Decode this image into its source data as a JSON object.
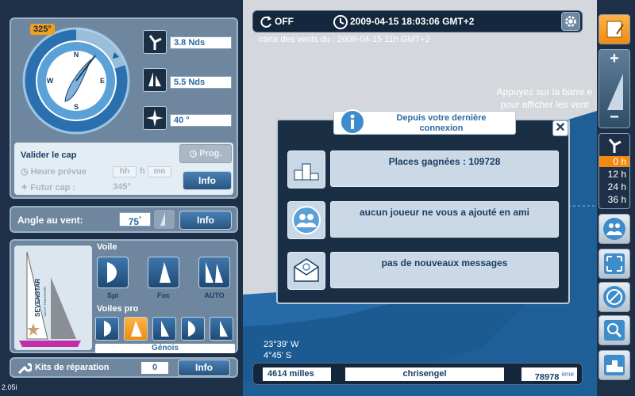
{
  "topbar": {
    "status": "OFF",
    "datetime": "2009-04-15 18:03:06 GMT+2"
  },
  "map": {
    "wind_date": "carte des vents du :  2009-04-15 11h GMT+2",
    "tip_line1": "Appuyez sur la barre e",
    "tip_line2": "pour afficher les vent",
    "lon": "23°39' W",
    "lat": "4°45' S"
  },
  "bottombar": {
    "distance": "4614 milles",
    "username": "chrisengel",
    "rank": "78978",
    "rank_suffix": "ème"
  },
  "compass": {
    "heading_badge": "325°",
    "dial_labels": [
      "N",
      "E",
      "S",
      "W"
    ]
  },
  "readings": {
    "wind_speed": "3.8 Nds",
    "boat_speed": "5.5 Nds",
    "wind_direction": "40 °"
  },
  "cap": {
    "title": "Valider le cap",
    "prog_label": "Prog.",
    "heure_label": "Heure prévue",
    "hh": "hh",
    "h": "h",
    "mn": "mn",
    "futur_label": "Futur cap :",
    "futur_value": "345°",
    "info_label": "Info"
  },
  "angle": {
    "label": "Angle au vent:",
    "value": "75",
    "unit": "°",
    "info_label": "Info"
  },
  "sails": {
    "voile_label": "Voile",
    "spi": "Spi",
    "foc": "Foc",
    "auto": "AUTO",
    "pro_label": "Voiles pro",
    "pro_selected": "Génois",
    "boat_brand": "SEVENSTAR",
    "boat_sub": "YACHT TRANSPORT"
  },
  "kits": {
    "label": "Kits de réparation",
    "value": "0",
    "info_label": "Info"
  },
  "version": "2.05i",
  "popup": {
    "title_line1": "Depuis votre dernière",
    "title_line2": "connexion",
    "close": "✕",
    "rows": [
      {
        "text": "Places gagnées :  109728"
      },
      {
        "text": "aucun joueur ne vous a ajouté en ami"
      },
      {
        "text": "pas de nouveaux messages"
      }
    ]
  },
  "toolbar": {
    "plus": "+",
    "minus": "−",
    "times": [
      "0 h",
      "12 h",
      "24 h",
      "36 h"
    ],
    "selected_time": "0 h"
  },
  "colors": {
    "panel": "#6e879e",
    "accent": "#f08a10",
    "sea": "#1f5f98",
    "land": "#d4d8dc",
    "button": "#27557f"
  }
}
